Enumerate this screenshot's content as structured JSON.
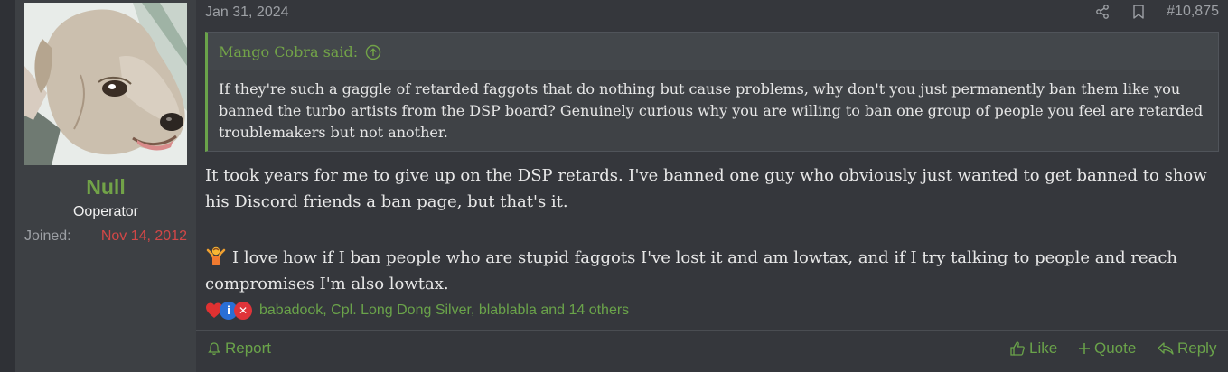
{
  "user": {
    "name": "Null",
    "title": "Ooperator",
    "joined_label": "Joined:",
    "joined_date": "Nov 14, 2012"
  },
  "post": {
    "date": "Jan 31, 2024",
    "number": "#10,875",
    "quote": {
      "author": "Mango Cobra said:",
      "text": "If they're such a gaggle of retarded faggots that do nothing but cause problems, why don't you just permanently ban them like you banned the turbo artists from the DSP board? Genuinely curious why you are willing to ban one group of people you feel are retarded troublemakers but not another."
    },
    "paragraphs": [
      "It took years for me to give up on the DSP retards. I've banned one guy who obviously just wanted to get banned to show his Discord friends a ban page, but that's it.",
      "I love how if I ban people who are stupid faggots I've lost it and am lowtax, and if I try talking to people and reach compromises I'm also lowtax."
    ],
    "reactions": {
      "info_glyph": "i",
      "x_glyph": "✕",
      "reactors": "babadook, Cpl. Long Dong Silver, blablabla and 14 others"
    }
  },
  "actions": {
    "report": "Report",
    "like": "Like",
    "quote": "Quote",
    "reply": "Reply"
  },
  "colors": {
    "accent_green": "#6aa34a",
    "joined_red": "#d24747",
    "background": "#35373c"
  }
}
